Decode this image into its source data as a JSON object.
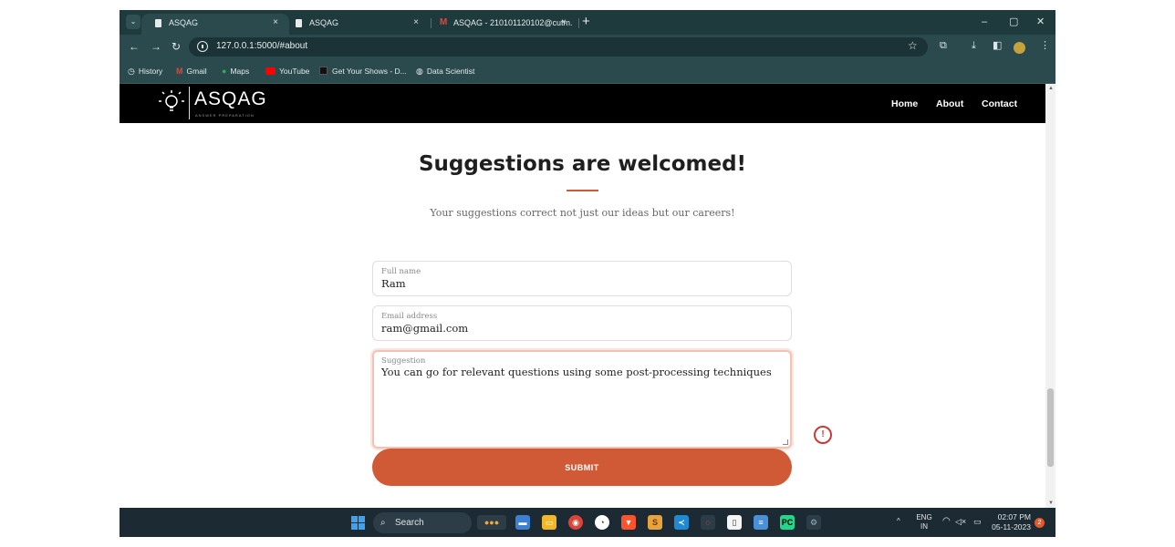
{
  "browser": {
    "tabs": [
      {
        "title": "ASQAG",
        "close": "×"
      },
      {
        "title": "ASQAG",
        "close": "×"
      },
      {
        "title": "ASQAG - 210101120102@cutm.",
        "close": "×"
      }
    ],
    "new_tab": "+",
    "window_controls": {
      "minimize": "–",
      "restore": "▢",
      "close": "✕"
    },
    "url": "127.0.0.1:5000/#about",
    "bookmarks": [
      {
        "label": "History",
        "icon": "history-icon"
      },
      {
        "label": "Gmail",
        "icon": "gmail-icon"
      },
      {
        "label": "Maps",
        "icon": "maps-icon"
      },
      {
        "label": "YouTube",
        "icon": "youtube-icon"
      },
      {
        "label": "Get Your Shows - D...",
        "icon": "site-icon"
      },
      {
        "label": "Data Scientist",
        "icon": "globe-icon"
      }
    ]
  },
  "site": {
    "logo_text": "ASQAG",
    "logo_tagline": "ANSWER PREPARATION",
    "nav": [
      {
        "label": "Home"
      },
      {
        "label": "About"
      },
      {
        "label": "Contact"
      }
    ]
  },
  "main": {
    "heading": "Suggestions are welcomed!",
    "subtitle": "Your suggestions correct not just our ideas but our careers!",
    "form": {
      "full_name": {
        "label": "Full name",
        "value": "Ram"
      },
      "email": {
        "label": "Email address",
        "value": "ram@gmail.com"
      },
      "suggestion": {
        "label": "Suggestion",
        "value": "You can go for relevant questions using some post-processing techniques"
      },
      "submit_label": "SUBMIT"
    }
  },
  "taskbar": {
    "search_placeholder": "Search",
    "language": "ENG",
    "region": "IN",
    "time": "02:07 PM",
    "date": "05-11-2023",
    "notification_count": "2"
  },
  "colors": {
    "accent": "#d05a35",
    "nav_bg": "#000000",
    "browser_chrome": "#2a4a4d"
  }
}
